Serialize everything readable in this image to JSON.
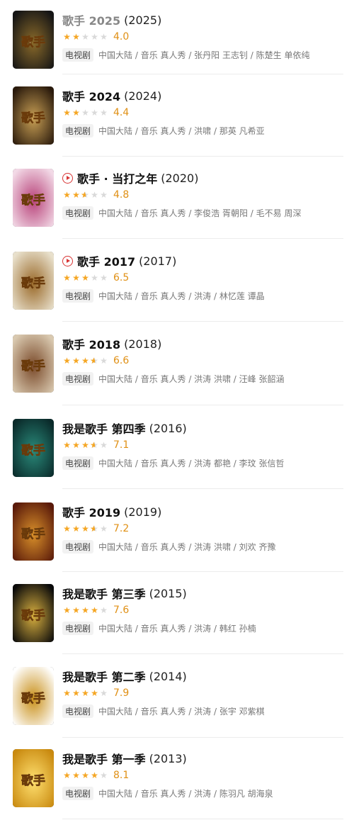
{
  "items": [
    {
      "title": "歌手 2025",
      "title_color": "#888888",
      "year": "(2025)",
      "has_play": false,
      "stars": [
        "full",
        "full",
        "empty",
        "empty",
        "empty"
      ],
      "score": "4.0",
      "badge": "电视剧",
      "meta": "中国大陆 / 音乐 真人秀 / 张丹阳 王志钊 / 陈楚生 单依纯",
      "poster_colors": [
        "#151515",
        "#8a6a2a"
      ],
      "poster_text": "歌手"
    },
    {
      "title": "歌手 2024",
      "year": "(2024)",
      "has_play": false,
      "stars": [
        "full",
        "full",
        "empty",
        "empty",
        "empty"
      ],
      "score": "4.4",
      "badge": "电视剧",
      "meta": "中国大陆 / 音乐 真人秀 / 洪啸 / 那英 凡希亚",
      "poster_colors": [
        "#2a1a0c",
        "#c9a055"
      ],
      "poster_text": "歌手"
    },
    {
      "title": "歌手 · 当打之年",
      "year": "(2020)",
      "has_play": true,
      "stars": [
        "full",
        "full",
        "half",
        "empty",
        "empty"
      ],
      "score": "4.8",
      "badge": "电视剧",
      "meta": "中国大陆 / 音乐 真人秀 / 李俊浩 胥朝阳 / 毛不易 周深",
      "poster_colors": [
        "#f2d9e6",
        "#b8437a"
      ],
      "poster_text": "歌手"
    },
    {
      "title": "歌手 2017",
      "year": "(2017)",
      "has_play": true,
      "stars": [
        "full",
        "full",
        "full",
        "empty",
        "empty"
      ],
      "score": "6.5",
      "badge": "电视剧",
      "meta": "中国大陆 / 音乐 真人秀 / 洪涛 / 林忆莲 谭晶",
      "poster_colors": [
        "#e8e0cc",
        "#9a6a2a"
      ],
      "poster_text": "歌手"
    },
    {
      "title": "歌手 2018",
      "year": "(2018)",
      "has_play": false,
      "stars": [
        "full",
        "full",
        "full",
        "half",
        "empty"
      ],
      "score": "6.6",
      "badge": "电视剧",
      "meta": "中国大陆 / 音乐 真人秀 / 洪涛 洪啸 / 汪峰 张韶涵",
      "poster_colors": [
        "#d9c9b0",
        "#7a4a2a"
      ],
      "poster_text": "歌手"
    },
    {
      "title": "我是歌手 第四季",
      "year": "(2016)",
      "has_play": false,
      "stars": [
        "full",
        "full",
        "full",
        "half",
        "empty"
      ],
      "score": "7.1",
      "badge": "电视剧",
      "meta": "中国大陆 / 音乐 真人秀 / 洪涛 都艳 / 李玟 张信哲",
      "poster_colors": [
        "#0a2a2a",
        "#2a8a7a"
      ],
      "poster_text": "歌手"
    },
    {
      "title": "歌手 2019",
      "year": "(2019)",
      "has_play": false,
      "stars": [
        "full",
        "full",
        "full",
        "half",
        "empty"
      ],
      "score": "7.2",
      "badge": "电视剧",
      "meta": "中国大陆 / 音乐 真人秀 / 洪涛 洪啸 / 刘欢 齐豫",
      "poster_colors": [
        "#5a1a0a",
        "#d9902a"
      ],
      "poster_text": "歌手"
    },
    {
      "title": "我是歌手 第三季",
      "year": "(2015)",
      "has_play": false,
      "stars": [
        "full",
        "full",
        "full",
        "full",
        "empty"
      ],
      "score": "7.6",
      "badge": "电视剧",
      "meta": "中国大陆 / 音乐 真人秀 / 洪涛 / 韩红 孙楠",
      "poster_colors": [
        "#0a0a0a",
        "#d9b040"
      ],
      "poster_text": "歌手"
    },
    {
      "title": "我是歌手 第二季",
      "year": "(2014)",
      "has_play": false,
      "stars": [
        "full",
        "full",
        "full",
        "full",
        "empty"
      ],
      "score": "7.9",
      "badge": "电视剧",
      "meta": "中国大陆 / 音乐 真人秀 / 洪涛 / 张宇 邓紫棋",
      "poster_colors": [
        "#ffffff",
        "#c9901a"
      ],
      "poster_text": "歌手"
    },
    {
      "title": "我是歌手 第一季",
      "year": "(2013)",
      "has_play": false,
      "stars": [
        "full",
        "full",
        "full",
        "full",
        "empty"
      ],
      "score": "8.1",
      "badge": "电视剧",
      "meta": "中国大陆 / 音乐 真人秀 / 洪涛 / 陈羽凡 胡海泉",
      "poster_colors": [
        "#c98a10",
        "#ffe070"
      ],
      "poster_text": "歌手"
    }
  ]
}
